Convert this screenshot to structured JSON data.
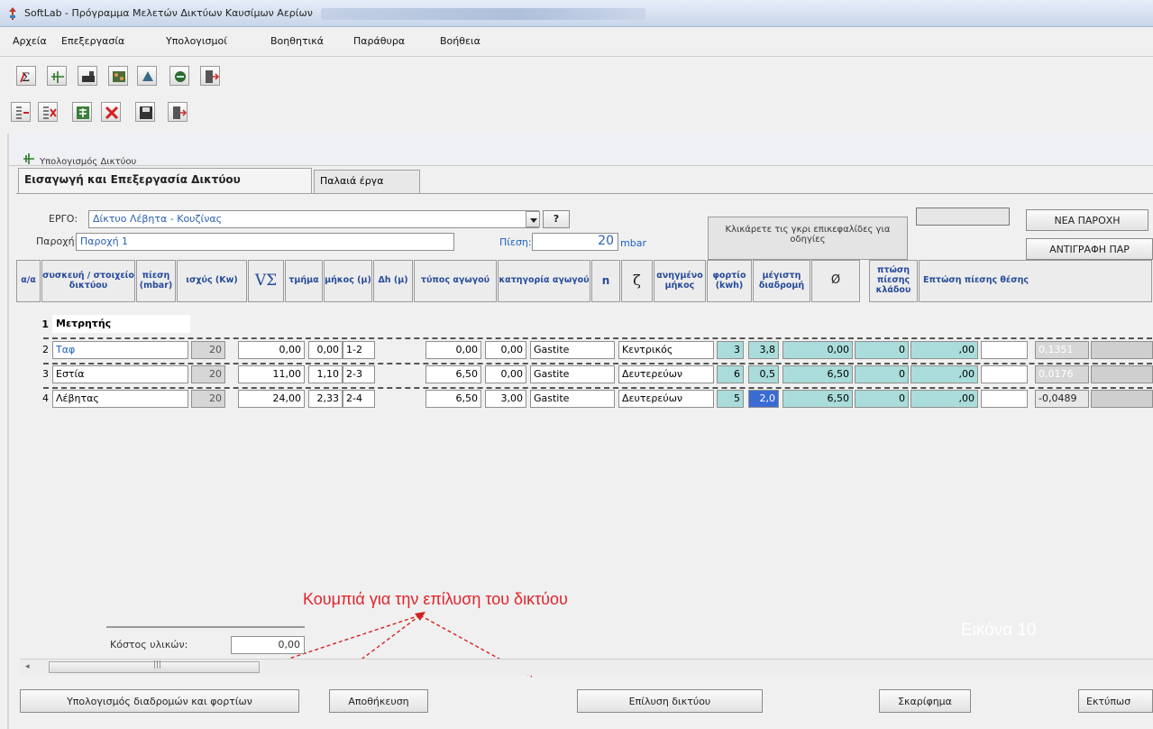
{
  "window": {
    "title": "SoftLab - Πρόγραμμα Μελετών Δικτύων Καυσίμων Αερίων"
  },
  "menu": [
    "Αρχεία",
    "Επεξεργασία",
    "Υπολογισμοί",
    "Βοηθητικά",
    "Παράθυρα",
    "Βοήθεια"
  ],
  "child": {
    "title": "Υπολογισμός Δικτύου"
  },
  "tabs": [
    "Εισαγωγή και Επεξεργασία Δικτύου",
    "Παλαιά έργα"
  ],
  "form": {
    "ergo_label": "ΕΡΓΟ:",
    "ergo_value": "Δίκτυο Λέβητα - Κουζίνας",
    "help_btn": "?",
    "paroxi_label": "Παροχή:",
    "paroxi_value": "Παροχή 1",
    "pressure_label": "Πίεση:",
    "pressure_value": "20",
    "pressure_unit": "mbar",
    "hint": "Κλικάρετε τις γκρι επικεφαλίδες για οδηγίες",
    "new_supply_btn": "ΝΕΑ ΠΑΡΟΧΗ",
    "copy_supply_btn": "ΑΝΤΙΓΡΑΦΗ ΠΑΡ"
  },
  "columns": [
    "α/α",
    "συσκευή / στοιχείο δικτύου",
    "πίεση (mbar)",
    "ισχύς (Kw)",
    "VΣ",
    "τμήμα",
    "μήκος (μ)",
    "Δh (μ)",
    "τύπος αγωγού",
    "κατηγορία αγωγού",
    "n",
    "ζ",
    "ανηγμένο μήκος",
    "φορτίο (kwh)",
    "μέγιστη διαδρομή",
    "Ø",
    "πτώση πίεσης κλάδου",
    "Επτώση πίεσης θέσης"
  ],
  "rows": [
    {
      "n": "1",
      "device": "Μετρητής"
    },
    {
      "n": "2",
      "device": "Ταφ",
      "pressure": "20",
      "power": "0,00",
      "v": "0,00",
      "segment": "1-2",
      "length": "0,00",
      "dh": "0,00",
      "type": "Gastite",
      "category": "Κεντρικός",
      "nn": "3",
      "z": "3,8",
      "eq_len": "0,00",
      "load": "0",
      "max_route": ",00",
      "drop": "0,1351"
    },
    {
      "n": "3",
      "device": "Εστία",
      "pressure": "20",
      "power": "11,00",
      "v": "1,10",
      "segment": "2-3",
      "length": "6,50",
      "dh": "0,00",
      "type": "Gastite",
      "category": "Δευτερεύων",
      "nn": "6",
      "z": "0,5",
      "eq_len": "6,50",
      "load": "0",
      "max_route": ",00",
      "drop": "0,0176"
    },
    {
      "n": "4",
      "device": "Λέβητας",
      "pressure": "20",
      "power": "24,00",
      "v": "2,33",
      "segment": "2-4",
      "length": "6,50",
      "dh": "3,00",
      "type": "Gastite",
      "category": "Δευτερεύων",
      "nn": "5",
      "z": "2,0",
      "eq_len": "6,50",
      "load": "0",
      "max_route": ",00",
      "drop": "-0,0489"
    }
  ],
  "cost": {
    "label": "Κόστος υλικών:",
    "value": "0,00"
  },
  "annotation": "Κουμπιά για την επίλυση του δικτύου",
  "figure_label": "Εικόνα 10",
  "buttons": {
    "routes": "Υπολογισμός διαδρομών και φορτίων",
    "save": "Αποθήκευση",
    "solve": "Επίλυση δικτύου",
    "sketch": "Σκαρίφημα",
    "print": "Εκτύπωσ"
  },
  "accent": {
    "teal": "#a9dcda",
    "header_blue": "#264a9c",
    "annotation_red": "#e0242b"
  }
}
